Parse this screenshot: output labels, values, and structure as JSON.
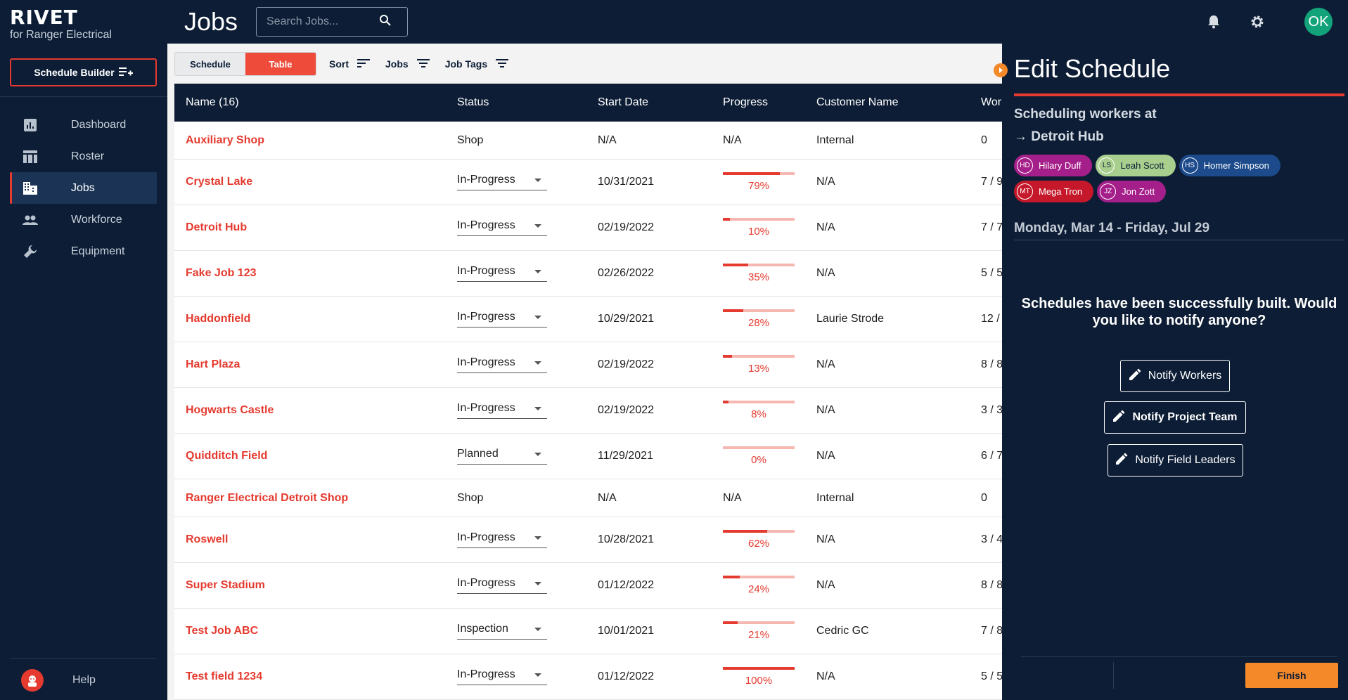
{
  "brand": {
    "name": "RIVET",
    "subtitle": "for Ranger Electrical"
  },
  "sidebar": {
    "schedule_builder_label": "Schedule Builder",
    "items": [
      {
        "label": "Dashboard",
        "icon": "dashboard-icon"
      },
      {
        "label": "Roster",
        "icon": "roster-icon"
      },
      {
        "label": "Jobs",
        "icon": "jobs-icon",
        "active": true
      },
      {
        "label": "Workforce",
        "icon": "workforce-icon"
      },
      {
        "label": "Equipment",
        "icon": "wrench-icon"
      }
    ],
    "help_label": "Help"
  },
  "header": {
    "title": "Jobs",
    "search_placeholder": "Search Jobs...",
    "user_initials": "OK"
  },
  "toolbar": {
    "view_schedule": "Schedule",
    "view_table": "Table",
    "sort_label": "Sort",
    "jobs_label": "Jobs",
    "tags_label": "Job Tags"
  },
  "table": {
    "columns": [
      "Name (16)",
      "Status",
      "Start Date",
      "Progress",
      "Customer Name",
      "Wor"
    ],
    "rows": [
      {
        "name": "Auxiliary Shop",
        "status": "Shop",
        "select": false,
        "start": "N/A",
        "progress": "N/A",
        "pct": null,
        "customer": "Internal",
        "workers": "0"
      },
      {
        "name": "Crystal Lake",
        "status": "In-Progress",
        "select": true,
        "start": "10/31/2021",
        "progress": "79%",
        "pct": 79,
        "customer": "N/A",
        "workers": "7 / 9"
      },
      {
        "name": "Detroit Hub",
        "status": "In-Progress",
        "select": true,
        "start": "02/19/2022",
        "progress": "10%",
        "pct": 10,
        "customer": "N/A",
        "workers": "7 / 7"
      },
      {
        "name": "Fake Job 123",
        "status": "In-Progress",
        "select": true,
        "start": "02/26/2022",
        "progress": "35%",
        "pct": 35,
        "customer": "N/A",
        "workers": "5 / 5"
      },
      {
        "name": "Haddonfield",
        "status": "In-Progress",
        "select": true,
        "start": "10/29/2021",
        "progress": "28%",
        "pct": 28,
        "customer": "Laurie Strode",
        "workers": "12 /"
      },
      {
        "name": "Hart Plaza",
        "status": "In-Progress",
        "select": true,
        "start": "02/19/2022",
        "progress": "13%",
        "pct": 13,
        "customer": "N/A",
        "workers": "8 / 8"
      },
      {
        "name": "Hogwarts Castle",
        "status": "In-Progress",
        "select": true,
        "start": "02/19/2022",
        "progress": "8%",
        "pct": 8,
        "customer": "N/A",
        "workers": "3 / 3"
      },
      {
        "name": "Quidditch Field",
        "status": "Planned",
        "select": true,
        "start": "11/29/2021",
        "progress": "0%",
        "pct": 0,
        "customer": "N/A",
        "workers": "6 / 7"
      },
      {
        "name": "Ranger Electrical Detroit Shop",
        "status": "Shop",
        "select": false,
        "start": "N/A",
        "progress": "N/A",
        "pct": null,
        "customer": "Internal",
        "workers": "0"
      },
      {
        "name": "Roswell",
        "status": "In-Progress",
        "select": true,
        "start": "10/28/2021",
        "progress": "62%",
        "pct": 62,
        "customer": "N/A",
        "workers": "3 / 4"
      },
      {
        "name": "Super Stadium",
        "status": "In-Progress",
        "select": true,
        "start": "01/12/2022",
        "progress": "24%",
        "pct": 24,
        "customer": "N/A",
        "workers": "8 / 8"
      },
      {
        "name": "Test Job ABC",
        "status": "Inspection",
        "select": true,
        "start": "10/01/2021",
        "progress": "21%",
        "pct": 21,
        "customer": "Cedric GC",
        "workers": "7 / 8"
      },
      {
        "name": "Test field 1234",
        "status": "In-Progress",
        "select": true,
        "start": "01/12/2022",
        "progress": "100%",
        "pct": 100,
        "customer": "N/A",
        "workers": "5 / 5"
      }
    ]
  },
  "panel": {
    "title": "Edit Schedule",
    "sub_line1": "Scheduling workers at",
    "sub_line2": "→ Detroit Hub",
    "workers": [
      {
        "initials": "HD",
        "name": "Hilary Duff",
        "color": "#a51f8a"
      },
      {
        "initials": "LS",
        "name": "Leah Scott",
        "color": "#a9cf8f"
      },
      {
        "initials": "HS",
        "name": "Homer Simpson",
        "color": "#1c4a8b"
      },
      {
        "initials": "MT",
        "name": "Mega Tron",
        "color": "#c5192b"
      },
      {
        "initials": "JZ",
        "name": "Jon Zott",
        "color": "#a51f8a"
      }
    ],
    "date_range": "Monday, Mar 14 - Friday, Jul 29",
    "message": "Schedules have been successfully built. Would you like to notify anyone?",
    "notify_workers": "Notify Workers",
    "notify_project_team": "Notify Project Team",
    "notify_field_leaders": "Notify Field Leaders",
    "finish": "Finish"
  },
  "colors": {
    "accent": "#e53a2f",
    "navy": "#0c1d35",
    "orange": "#f4892a",
    "avatar": "#12a37a"
  }
}
